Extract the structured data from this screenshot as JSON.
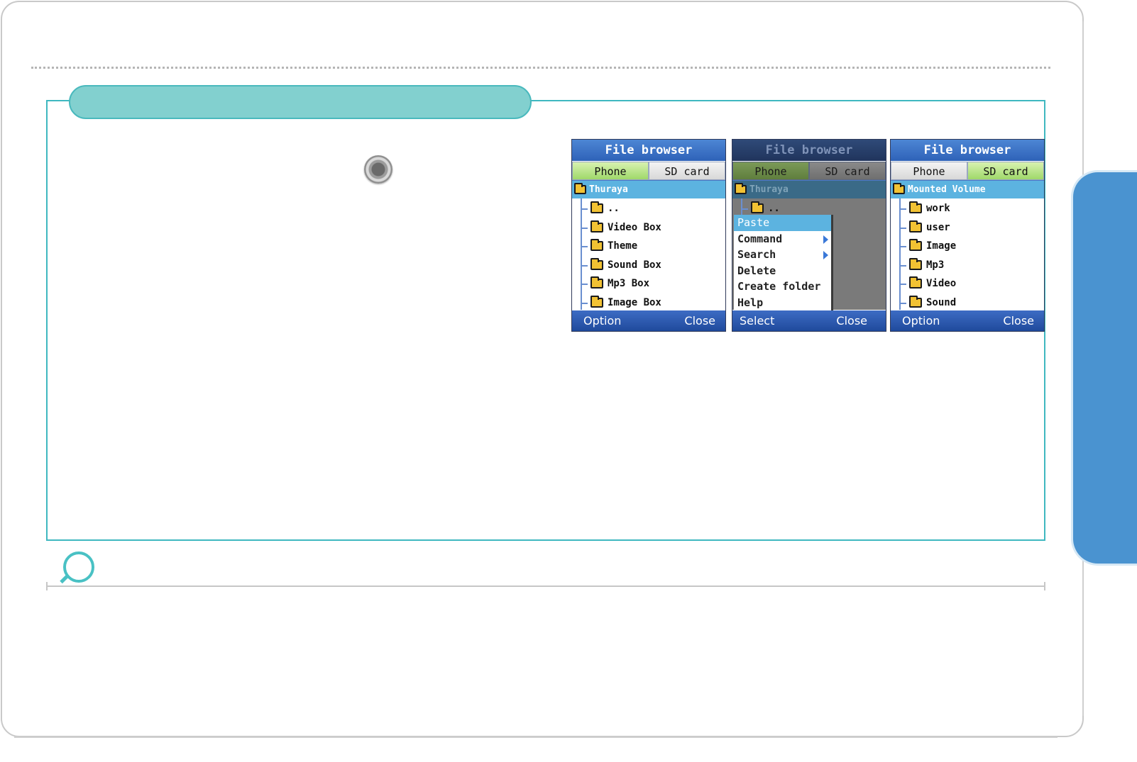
{
  "colors": {
    "accent_teal": "#3fb8c0",
    "pill_teal": "#82d0cf",
    "side_tab_blue": "#4a93d0",
    "highlight_blue": "#5cb3e0",
    "tab_active_green": "#9fd86a"
  },
  "screens": [
    {
      "title": "File browser",
      "tabs": [
        {
          "label": "Phone",
          "active": true
        },
        {
          "label": "SD card",
          "active": false
        }
      ],
      "root": "Thuraya",
      "items": [
        "..",
        "Video Box",
        "Theme",
        "Sound Box",
        "Mp3 Box",
        "Image Box"
      ],
      "softkeys": {
        "left": "Option",
        "right": "Close"
      }
    },
    {
      "title": "File browser",
      "tabs": [
        {
          "label": "Phone",
          "active": true
        },
        {
          "label": "SD card",
          "active": false
        }
      ],
      "root": "Thuraya",
      "items": [
        ".."
      ],
      "menu": [
        {
          "label": "Paste",
          "selected": true,
          "submenu": false
        },
        {
          "label": "Command",
          "selected": false,
          "submenu": true
        },
        {
          "label": "Search",
          "selected": false,
          "submenu": true
        },
        {
          "label": "Delete",
          "selected": false,
          "submenu": false
        },
        {
          "label": "Create folder",
          "selected": false,
          "submenu": false
        },
        {
          "label": "Help",
          "selected": false,
          "submenu": false
        }
      ],
      "softkeys": {
        "left": "Select",
        "right": "Close"
      }
    },
    {
      "title": "File browser",
      "tabs": [
        {
          "label": "Phone",
          "active": false
        },
        {
          "label": "SD card",
          "active": true
        }
      ],
      "root": "Mounted Volume",
      "items": [
        "work",
        "user",
        "Image",
        "Mp3",
        "Video",
        "Sound"
      ],
      "softkeys": {
        "left": "Option",
        "right": "Close"
      }
    }
  ],
  "icons": {
    "joystick": "joystick-icon",
    "note": "magnifier-icon",
    "folder": "folder-icon"
  }
}
